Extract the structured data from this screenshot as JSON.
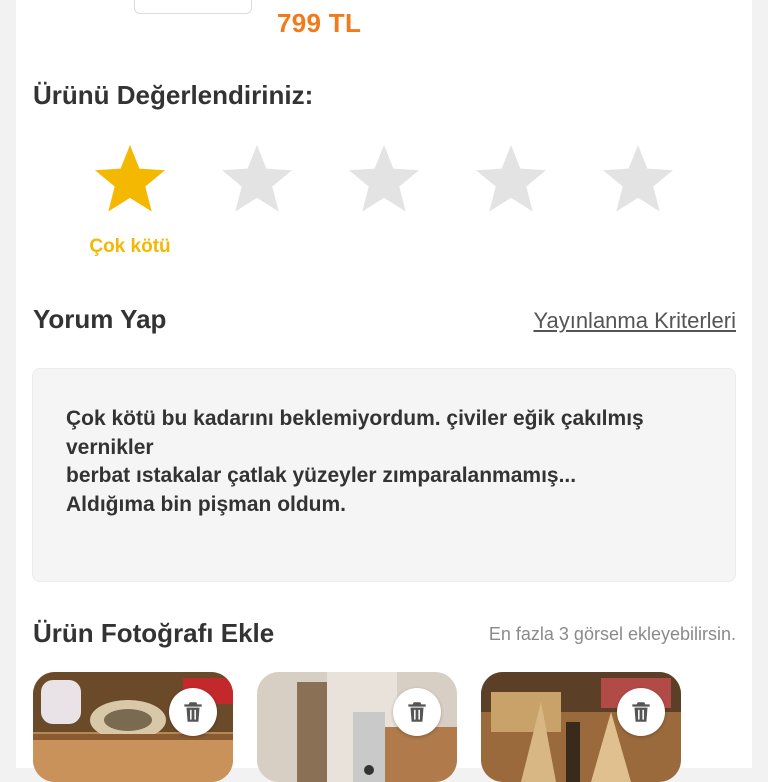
{
  "product": {
    "price": "799 TL"
  },
  "rating": {
    "title": "Ürünü Değerlendiriniz:",
    "selected": 1,
    "max": 5,
    "selected_label": "Çok kötü",
    "active_color": "#f5b800",
    "inactive_color": "#e3e3e3"
  },
  "comment": {
    "title": "Yorum Yap",
    "criteria_link": "Yayınlanma Kriterleri",
    "text": "Çok kötü bu kadarını beklemiyordum. çiviler eğik çakılmış vernikler\nberbat ıstakalar çatlak yüzeyler zımparalanmamış...\nAldığıma bin pişman oldum."
  },
  "photos": {
    "title": "Ürün Fotoğrafı Ekle",
    "hint": "En fazla 3 görsel ekleyebilirsin.",
    "items": [
      {
        "icon": "trash-icon"
      },
      {
        "icon": "trash-icon"
      },
      {
        "icon": "trash-icon"
      }
    ]
  }
}
